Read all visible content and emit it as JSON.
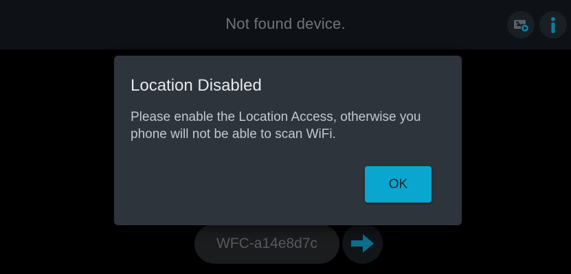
{
  "header": {
    "title": "Not found device.",
    "actions": [
      {
        "icon": "video-playback-icon",
        "interactable": true
      },
      {
        "icon": "info-icon",
        "interactable": true
      }
    ]
  },
  "device": {
    "name": "WFC-a14e8d7c",
    "connect_icon": "arrow-right-icon"
  },
  "dialog": {
    "title": "Location Disabled",
    "message": "Please enable the Location Access, otherwise you phone will not be able to scan WiFi.",
    "ok_label": "OK"
  },
  "colors": {
    "accent": "#0aa6cf",
    "background": "#000000",
    "topbar": "#0e1115",
    "dialog_bg": "#2e343c"
  }
}
